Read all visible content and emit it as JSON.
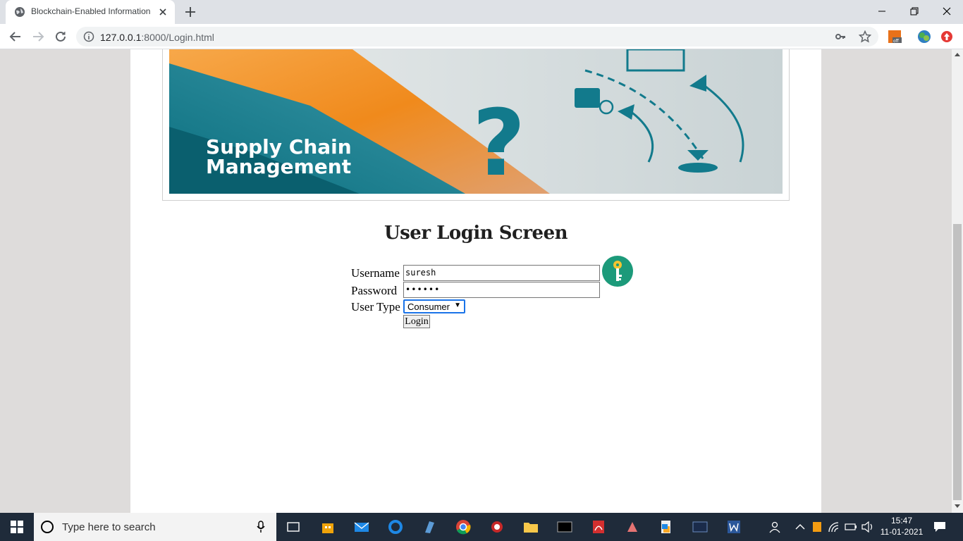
{
  "browser": {
    "tab_title": "Blockchain-Enabled Information",
    "url_host": "127.0.0.1",
    "url_rest": ":8000/Login.html"
  },
  "banner": {
    "line1": "Supply Chain",
    "line2": "Management",
    "question": "?"
  },
  "page": {
    "heading": "User Login Screen"
  },
  "form": {
    "username_label": "Username",
    "username_value": "suresh",
    "password_label": "Password",
    "password_value": "••••••",
    "usertype_label": "User Type",
    "usertype_selected": "Consumer",
    "login_label": "Login"
  },
  "taskbar": {
    "search_placeholder": "Type here to search",
    "time": "15:47",
    "date": "11-01-2021"
  },
  "colors": {
    "accent_teal": "#127a8c",
    "banner_orange": "#f08a1c",
    "key_badge": "#1c9a7a",
    "focus_blue": "#1a73e8"
  }
}
